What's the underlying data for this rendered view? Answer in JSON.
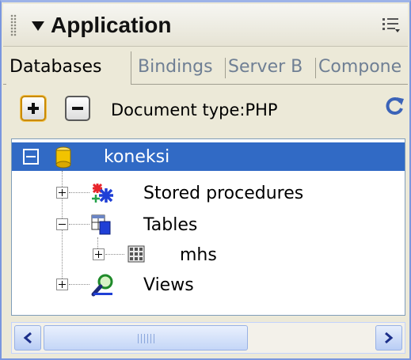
{
  "panel": {
    "title": "Application"
  },
  "tabs": [
    {
      "label": "Databases",
      "active": true
    },
    {
      "label": "Bindings",
      "active": false
    },
    {
      "label": "Server B",
      "active": false
    },
    {
      "label": "Compone",
      "active": false
    }
  ],
  "toolbar": {
    "document_type": "Document type:PHP"
  },
  "tree": {
    "connection": "koneksi",
    "stored_procedures": "Stored procedures",
    "tables": "Tables",
    "table_mhs": "mhs",
    "views": "Views"
  },
  "colors": {
    "selection": "#316ac5",
    "panel_bg": "#ece9d8",
    "accent_border": "#7a96df"
  },
  "icons": {
    "grip": "grip-dots-icon",
    "collapse": "triangle-down-icon",
    "options": "panel-options-icon",
    "add": "plus-icon",
    "remove": "minus-icon",
    "refresh": "refresh-icon",
    "database": "database-cylinder-icon",
    "procedures": "asterisk-icon",
    "tables": "tables-icon",
    "table": "grid-icon",
    "views": "magnifier-icon"
  }
}
